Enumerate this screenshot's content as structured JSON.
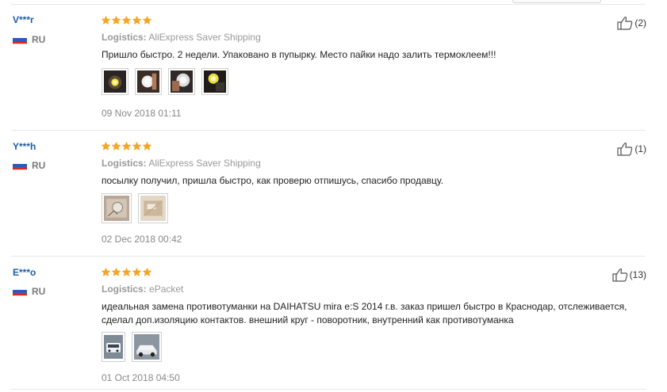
{
  "logistics_label": "Logistics:",
  "colors": {
    "star": "#f5a623",
    "username": "#1a5da8"
  },
  "reviews": [
    {
      "user": "V***r",
      "country": "RU",
      "rating": 5,
      "logistics": "AliExpress Saver Shipping",
      "text": "Пришло быстро. 2 недели. Упаковано в пупырку. Место пайки надо залить термоклеем!!!",
      "date": "09 Nov 2018 01:11",
      "helpful": "(2)",
      "photos": [
        "photo-led-bulb-lit",
        "photo-led-bulb-white",
        "photo-led-bulb-held",
        "photo-led-bulb-yellow"
      ]
    },
    {
      "user": "Y***h",
      "country": "RU",
      "rating": 5,
      "logistics": "AliExpress Saver Shipping",
      "text": "посылку получил, пришла быстро, как проверю отпишусь, спасибо продавцу.",
      "date": "02 Dec 2018 00:42",
      "helpful": "(1)",
      "photos": [
        "photo-package",
        "photo-package-open"
      ]
    },
    {
      "user": "E***o",
      "country": "RU",
      "rating": 5,
      "logistics": "ePacket",
      "text": "идеальная замена противотуманки на DAIHATSU mira e:S 2014 г.в. заказ пришел быстро в Краснодар, отслеживается, сделал доп.изоляцию контактов. внешний круг - поворотник, внутренний как противотуманка",
      "date": "01 Oct 2018 04:50",
      "helpful": "(13)",
      "photos": [
        "photo-car-front",
        "photo-car-side"
      ]
    }
  ]
}
